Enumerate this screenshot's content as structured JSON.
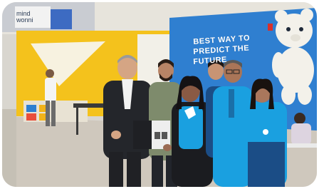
{
  "photo": {
    "wall_sign_lines": [
      "BEST WAY TO",
      "PREDICT THE",
      "FUTURE"
    ],
    "banner_text": "mind\nwonni",
    "colors": {
      "yellow_wall": "#f4c21c",
      "blue_wall": "#2f7fd0",
      "team_shirt": "#1aa0e0",
      "floor": "#cfc8bd",
      "ceiling": "#e7e4dc"
    }
  }
}
